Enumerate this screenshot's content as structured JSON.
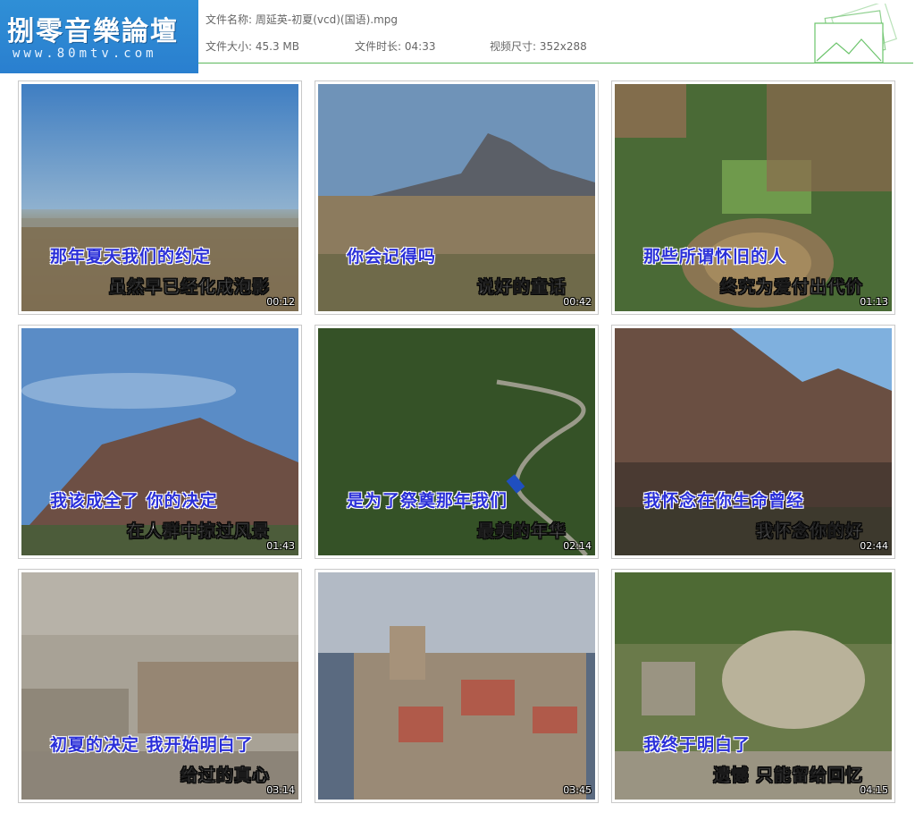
{
  "header": {
    "logo_title": "捌零音樂論壇",
    "logo_url": "www.80mtv.com",
    "file_name_label": "文件名称:",
    "file_name": "周延英-初夏(vcd)(国语).mpg",
    "file_size_label": "文件大小:",
    "file_size": "45.3 MB",
    "duration_label": "文件时长:",
    "duration": "04:33",
    "video_size_label": "视频尺寸:",
    "video_size": "352x288"
  },
  "colors": {
    "accent_line": "#5cb85c",
    "logo_bg": "#2f8fd6",
    "lyric_highlight": "#2a2fd8"
  },
  "thumbnails": [
    {
      "time": "00:12",
      "line1": "那年夏天我们的约定",
      "line2": "虽然早已经化成泡影",
      "scene": "sky-city"
    },
    {
      "time": "00:42",
      "line1": "你会记得吗",
      "line2": "说好的童话",
      "scene": "volcano-city"
    },
    {
      "time": "01:13",
      "line1": "那些所谓怀旧的人",
      "line2": "终究为爱付出代价",
      "scene": "arena-aerial"
    },
    {
      "time": "01:43",
      "line1": "我该成全了 你的决定",
      "line2": "在人群中掠过风景",
      "scene": "volcano-sky"
    },
    {
      "time": "02:14",
      "line1": "是为了祭奠那年我们",
      "line2": "最美的年华",
      "scene": "forest-road"
    },
    {
      "time": "02:44",
      "line1": "我怀念在你生命曾经",
      "line2": "我怀念你的好",
      "scene": "cliffs"
    },
    {
      "time": "03:14",
      "line1": "初夏的决定 我开始明白了",
      "line2": "给过的真心",
      "scene": "dense-city"
    },
    {
      "time": "03:45",
      "line1": "",
      "line2": "",
      "scene": "castle-harbor"
    },
    {
      "time": "04:15",
      "line1": "我终于明白了",
      "line2": "遗憾 只能留给回忆",
      "scene": "ruins"
    }
  ]
}
